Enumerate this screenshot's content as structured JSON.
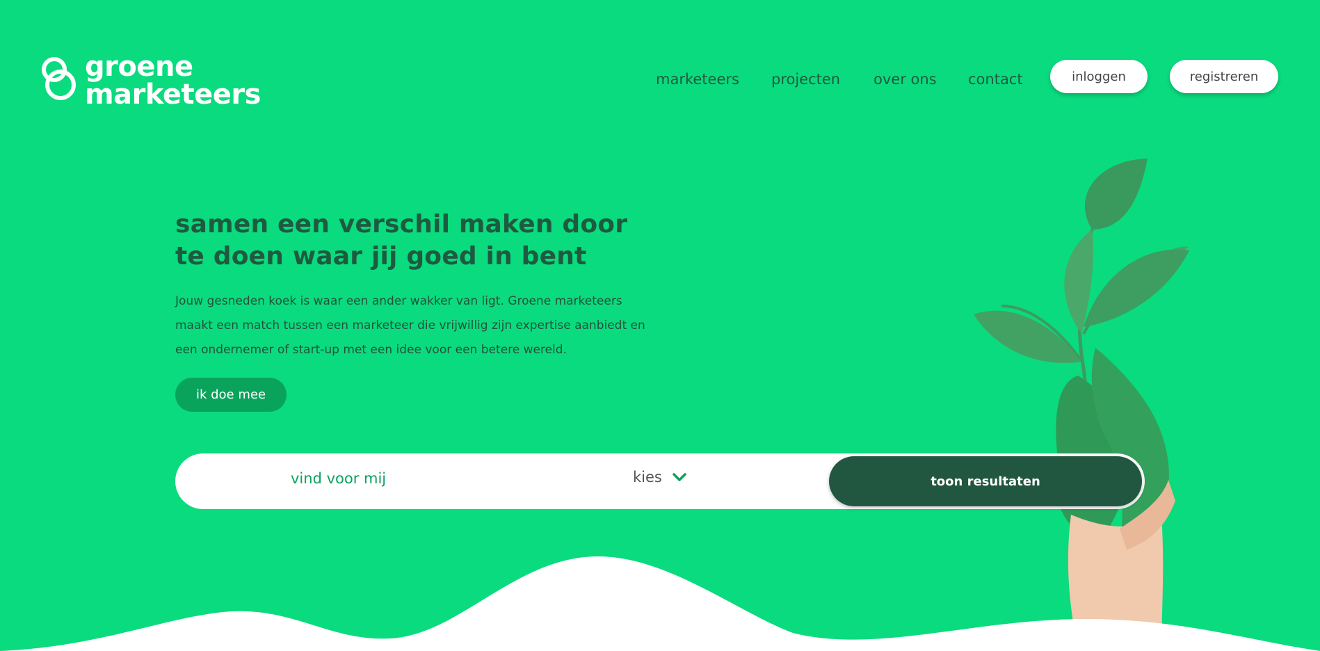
{
  "brand": {
    "line1": "groene",
    "line2": "marketeers"
  },
  "nav": {
    "links": [
      "marketeers",
      "projecten",
      "over ons",
      "contact"
    ],
    "login_label": "inloggen",
    "register_label": "registreren"
  },
  "hero": {
    "title": "samen een verschil maken door te doen waar jij goed in bent",
    "body": "Jouw gesneden koek is waar een ander wakker van ligt. Groene marketeers maakt een match tussen een marketeer die vrijwillig zijn expertise aanbiedt en een ondernemer of start-up met een idee voor een betere wereld.",
    "cta_label": "ik doe mee"
  },
  "search": {
    "label": "vind voor mij",
    "select_value": "kies",
    "submit_label": "toon resultaten"
  },
  "colors": {
    "background": "#0adb7e",
    "accent_dark": "#215640",
    "accent": "#0aa35c",
    "heading": "#1e5a40"
  },
  "icons": {
    "logo": "interlocking-rings-icon",
    "dropdown": "chevron-down-icon"
  }
}
